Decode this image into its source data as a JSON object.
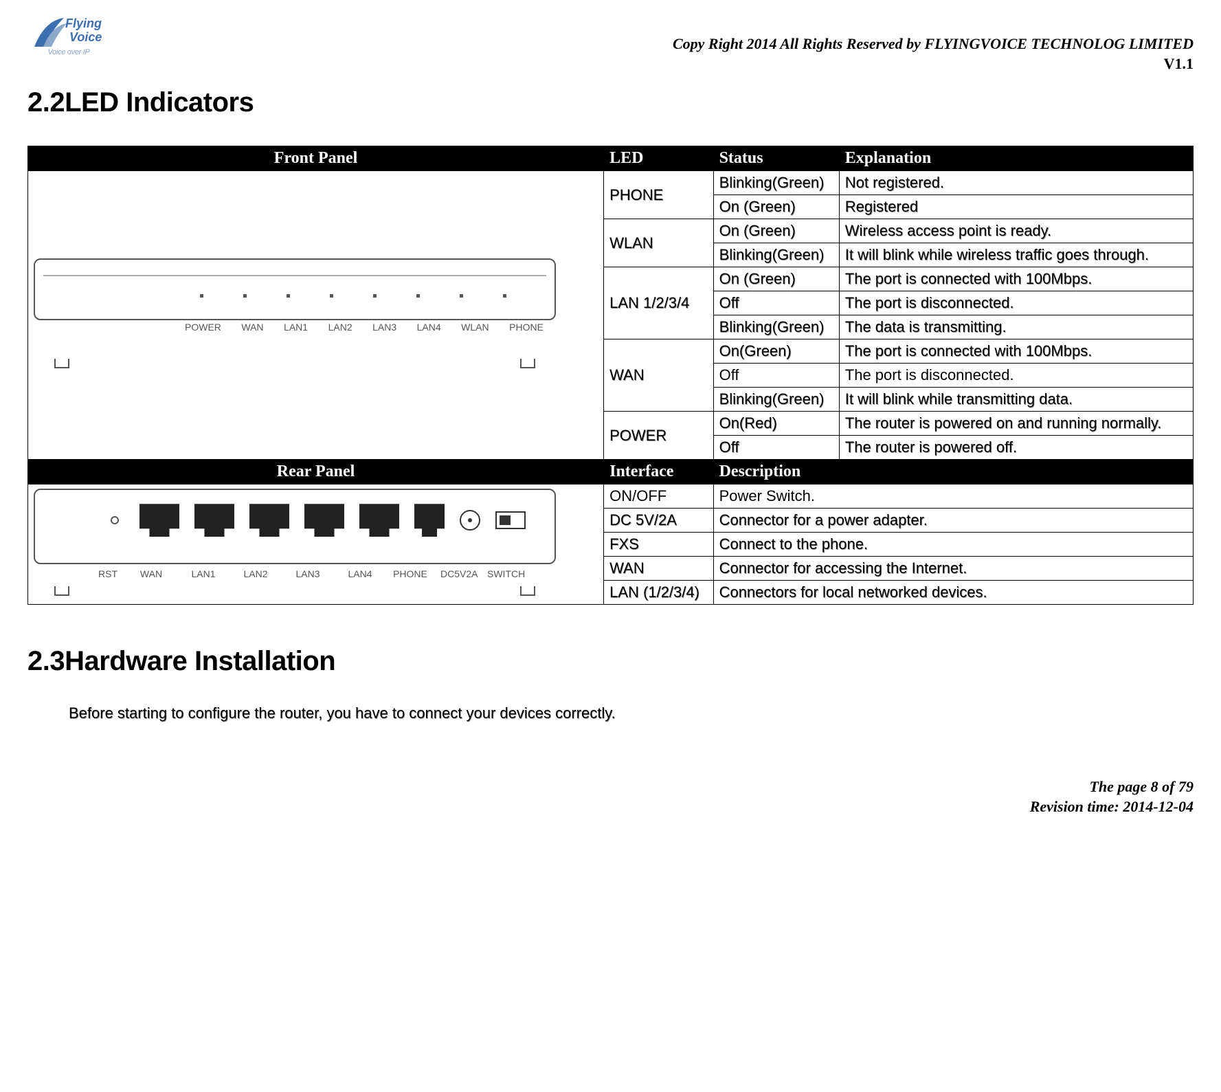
{
  "logo": {
    "line1": "Flying",
    "line2": "Voice",
    "tagline": "Voice over IP"
  },
  "copyright": "Copy Right 2014 All Rights Reserved by FLYINGVOICE TECHNOLOG LIMITED",
  "version": "V1.1",
  "section_led_title": "2.2LED Indicators",
  "section_hw_title": "2.3Hardware Installation",
  "hw_intro": "Before starting to configure the router, you have to connect your devices correctly.",
  "footer_page": "The page 8 of 79",
  "footer_rev": "Revision time: 2014-12-04",
  "headers_front": {
    "panel": "Front Panel",
    "led": "LED",
    "status": "Status",
    "expl": "Explanation"
  },
  "headers_rear": {
    "panel": "Rear Panel",
    "iface": "Interface",
    "desc": "Description"
  },
  "front_labels": [
    "POWER",
    "WAN",
    "LAN1",
    "LAN2",
    "LAN3",
    "LAN4",
    "WLAN",
    "PHONE"
  ],
  "rear_labels": [
    "RST",
    "WAN",
    "LAN1",
    "LAN2",
    "LAN3",
    "LAN4",
    "PHONE",
    "DC5V2A",
    "SWITCH"
  ],
  "leds": {
    "phone": {
      "name": "PHONE",
      "rows": [
        {
          "status": "Blinking(Green)",
          "expl": "Not registered."
        },
        {
          "status": "On (Green)",
          "expl": "Registered"
        }
      ]
    },
    "wlan": {
      "name": "WLAN",
      "rows": [
        {
          "status": "On (Green)",
          "expl": "Wireless access point is ready."
        },
        {
          "status": "Blinking(Green)",
          "expl": "It will blink while wireless traffic goes through."
        }
      ]
    },
    "lan": {
      "name": "LAN 1/2/3/4",
      "rows": [
        {
          "status": "On (Green)",
          "expl": "The port is connected with 100Mbps."
        },
        {
          "status": "Off",
          "expl": "The port is disconnected."
        },
        {
          "status": "Blinking(Green)",
          "expl": "The data is transmitting."
        }
      ]
    },
    "wan": {
      "name": "WAN",
      "rows": [
        {
          "status": "On(Green)",
          "expl": "The port is connected with 100Mbps."
        },
        {
          "status": "Off",
          "expl": "The port is disconnected."
        },
        {
          "status": "Blinking(Green)",
          "expl": "It will blink while transmitting data."
        }
      ]
    },
    "power": {
      "name": "POWER",
      "rows": [
        {
          "status": "On(Red)",
          "expl": "The router is powered on and running normally."
        },
        {
          "status": "Off",
          "expl": "The router is powered off."
        }
      ]
    }
  },
  "rear": [
    {
      "iface": "ON/OFF",
      "desc": "Power Switch."
    },
    {
      "iface": "DC 5V/2A",
      "desc": "Connector for a power adapter."
    },
    {
      "iface": "FXS",
      "desc": "Connect to the phone."
    },
    {
      "iface": "WAN",
      "desc": "Connector for accessing the Internet."
    },
    {
      "iface": "LAN (1/2/3/4)",
      "desc": "Connectors for local networked devices."
    }
  ]
}
